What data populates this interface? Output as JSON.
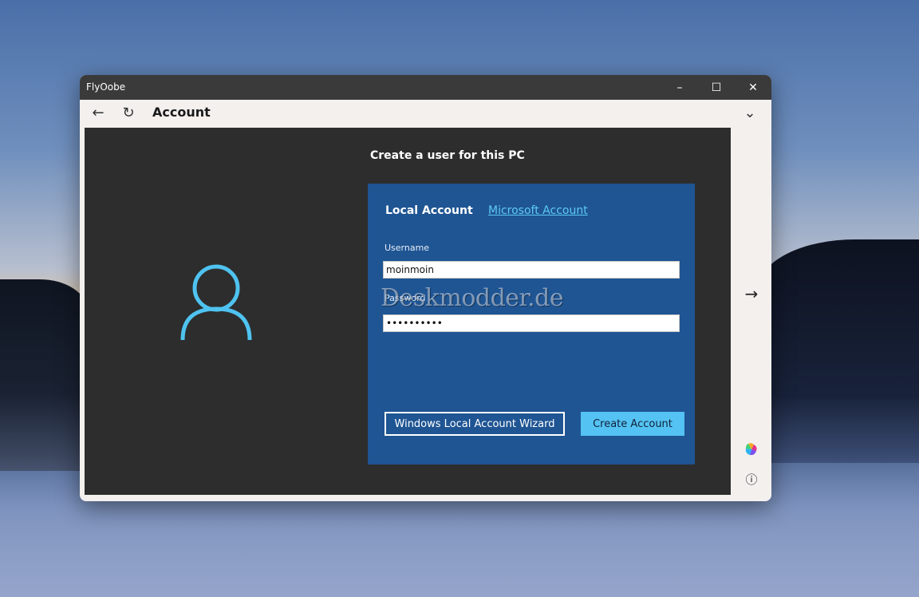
{
  "window": {
    "title": "FlyOobe",
    "controls": {
      "minimize": "–",
      "maximize": "☐",
      "close": "✕"
    }
  },
  "toolbar": {
    "back_icon": "←",
    "refresh_icon": "↻",
    "page_title": "Account",
    "expand_icon": "⌄"
  },
  "main": {
    "heading": "Create a user for this PC",
    "tabs": {
      "local": "Local Account",
      "microsoft": "Microsoft Account"
    },
    "username_label": "Username",
    "username_value": "moinmoin",
    "password_label": "Password",
    "password_value": "moinmoinmo",
    "watermark": "Deskmodder.de",
    "wizard_button": "Windows Local Account Wizard",
    "create_button": "Create Account"
  },
  "side": {
    "next_icon": "→",
    "info_icon": "ⓘ"
  },
  "colors": {
    "accent": "#54c3f3",
    "card": "#1f5593",
    "content_bg": "#2d2d2d",
    "avatar": "#4fc3f0"
  }
}
